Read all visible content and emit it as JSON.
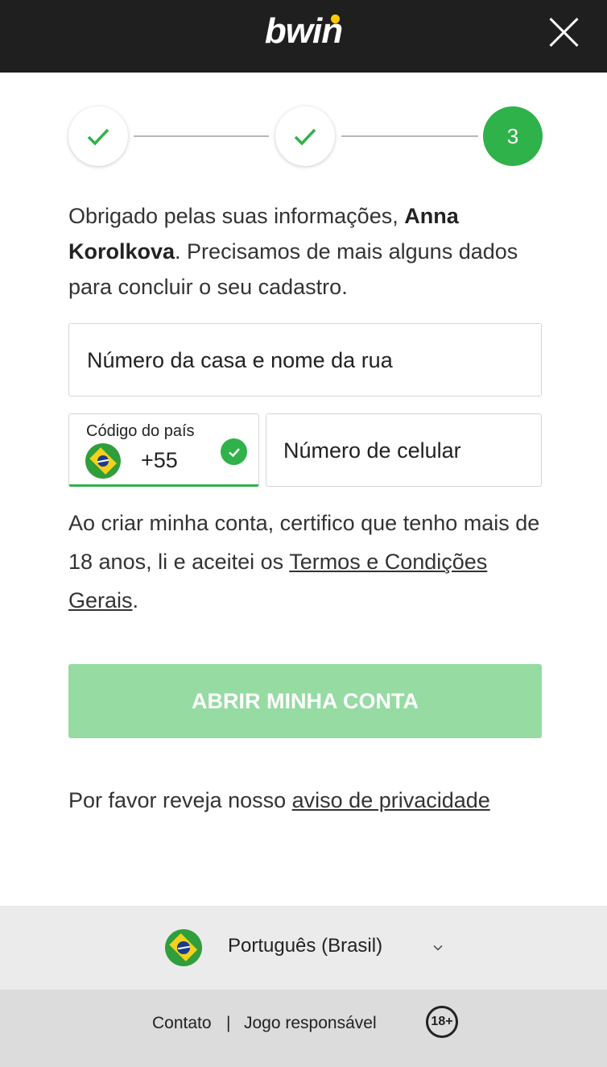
{
  "header": {
    "logo_text": "bwin"
  },
  "stepper": {
    "steps": [
      {
        "state": "done"
      },
      {
        "state": "done"
      },
      {
        "state": "active",
        "label": "3"
      }
    ]
  },
  "intro": {
    "prefix": "Obrigado pelas suas informações, ",
    "name": "Anna Korolkova",
    "suffix": ". Precisamos de mais alguns dados para concluir o seu cadastro."
  },
  "form": {
    "address_placeholder": "Número da casa e nome da rua",
    "country_label": "Código do país",
    "country_code": "+55",
    "phone_placeholder": "Número de celular"
  },
  "terms": {
    "text": "Ao criar minha conta, certifico que tenho mais de 18 anos, li e aceitei os ",
    "link": "Termos e Condições Gerais",
    "end": "."
  },
  "cta": {
    "label": "ABRIR MINHA CONTA"
  },
  "privacy": {
    "text": "Por favor reveja nosso ",
    "link": "aviso de privacidade"
  },
  "language": {
    "label": "Português (Brasil)"
  },
  "footer": {
    "contact": "Contato",
    "separator": "|",
    "responsible": "Jogo responsável",
    "age": "18+"
  },
  "colors": {
    "accent": "#2fb24a",
    "cta_disabled": "#95dba2",
    "header_bg": "#1f1f1f"
  }
}
